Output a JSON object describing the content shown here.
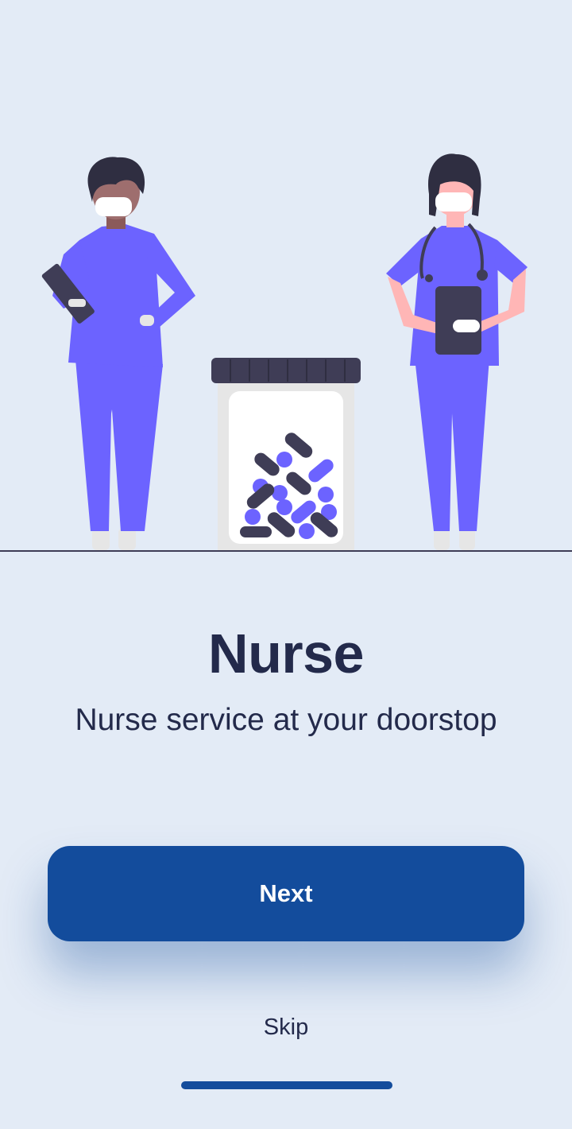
{
  "onboarding": {
    "title": "Nurse",
    "subtitle": "Nurse service at your doorstop",
    "next_label": "Next",
    "skip_label": "Skip"
  },
  "illustration": {
    "icon": "nurses-with-pill-jar-illustration"
  },
  "colors": {
    "background": "#e3ebf6",
    "primary": "#134c9c",
    "text": "#232a4b",
    "scrubs": "#6c63ff"
  }
}
